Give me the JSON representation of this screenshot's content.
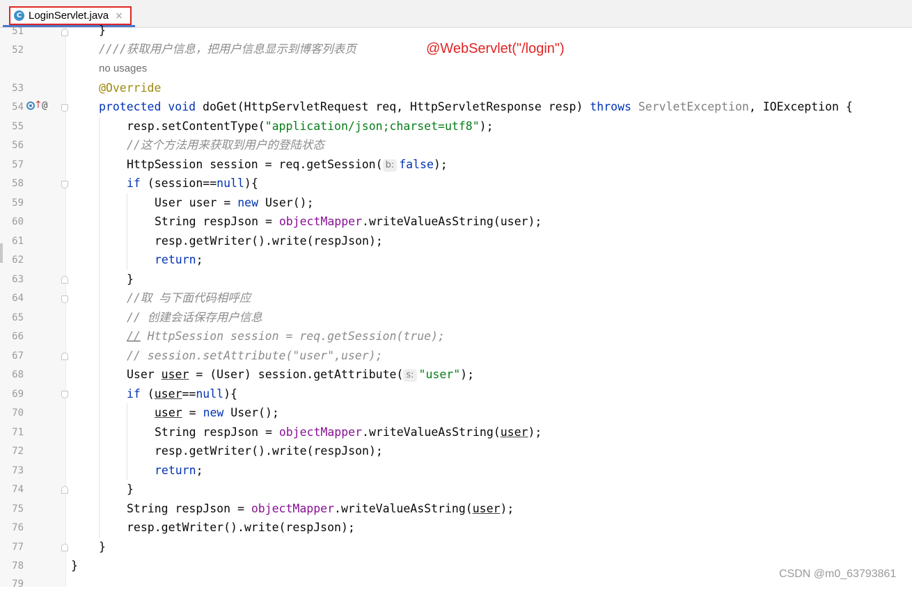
{
  "tab": {
    "icon_letter": "C",
    "filename": "LoginServlet.java",
    "close_glyph": "×"
  },
  "annotation_overlay": "@WebServlet(\"/login\")",
  "watermark": "CSDN @m0_63793861",
  "inlay_usages": "no usages",
  "line_numbers": [
    "51",
    "52",
    "53",
    "54",
    "55",
    "56",
    "57",
    "58",
    "59",
    "60",
    "61",
    "62",
    "63",
    "64",
    "65",
    "66",
    "67",
    "68",
    "69",
    "70",
    "71",
    "72",
    "73",
    "74",
    "75",
    "76",
    "77",
    "78",
    "79"
  ],
  "code": {
    "l51": "}",
    "l52": "////获取用户信息，把用户信息显示到博客列表页",
    "l53": "@Override",
    "l54": {
      "protected": "protected",
      "void": "void",
      "sig_a": " doGet(HttpServletRequest req, HttpServletResponse resp) ",
      "throws": "throws",
      "servlet_exc": " ServletException",
      "sig_b": ", IOException {"
    },
    "l55": {
      "a": "resp.setContentType(",
      "str": "\"application/json;charset=utf8\"",
      "b": ");"
    },
    "l56": "//这个方法用来获取到用户的登陆状态",
    "l57": {
      "a": "HttpSession session = req.getSession(",
      "hint": "b:",
      "val": "false",
      "b": ");"
    },
    "l58": {
      "if": "if",
      "a": " (session==",
      "null": "null",
      "b": "){"
    },
    "l59": {
      "a": "User user = ",
      "new": "new",
      "b": " User();"
    },
    "l60": {
      "a": "String respJson = ",
      "fld": "objectMapper",
      "b": ".writeValueAsString(user);"
    },
    "l61": "resp.getWriter().write(respJson);",
    "l62": {
      "ret": "return",
      "b": ";"
    },
    "l63": "}",
    "l64": "//取 与下面代码相呼应",
    "l65": "// 创建会话保存用户信息",
    "l66": {
      "slashes": "//",
      "rest": " HttpSession session = req.getSession(true);"
    },
    "l67": "// session.setAttribute(\"user\",user);",
    "l68": {
      "a": "User ",
      "user": "user",
      "b": " = (User) session.getAttribute(",
      "hint": "s:",
      "str": "\"user\"",
      "c": ");"
    },
    "l69": {
      "if": "if",
      "a": " (",
      "user": "user",
      "b": "==",
      "null": "null",
      "c": "){"
    },
    "l70": {
      "user": "user",
      "a": " = ",
      "new": "new",
      "b": " User();"
    },
    "l71": {
      "a": "String respJson = ",
      "fld": "objectMapper",
      "b": ".writeValueAsString(",
      "user": "user",
      "c": ");"
    },
    "l72": "resp.getWriter().write(respJson);",
    "l73": {
      "ret": "return",
      "b": ";"
    },
    "l74": "}",
    "l75": {
      "a": "String respJson = ",
      "fld": "objectMapper",
      "b": ".writeValueAsString(",
      "user": "user",
      "c": ");"
    },
    "l76": "resp.getWriter().write(respJson);",
    "l77": "}",
    "l78": "}"
  }
}
